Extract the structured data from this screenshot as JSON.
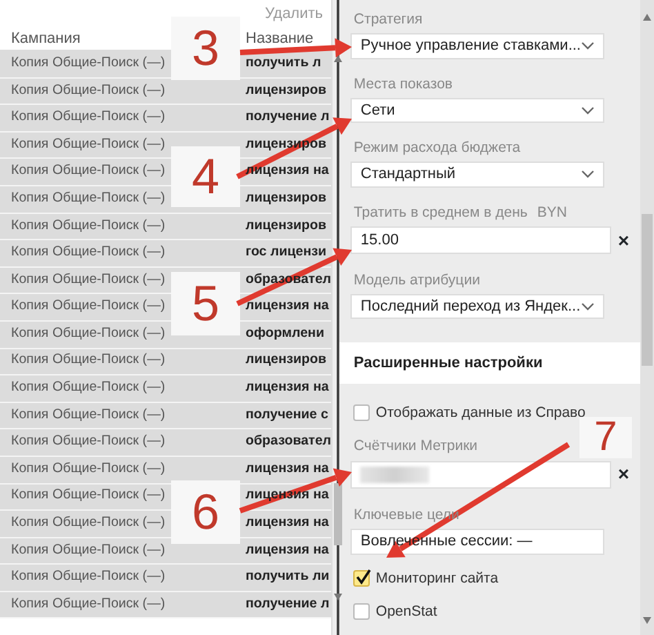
{
  "toolbar": {
    "delete_link": "Удалить"
  },
  "table": {
    "columns": [
      "Кампания",
      "Название"
    ],
    "rows": [
      {
        "campaign": "Копия Общие-Поиск (—)",
        "name": "получить л"
      },
      {
        "campaign": "Копия Общие-Поиск (—)",
        "name": "лицензиров"
      },
      {
        "campaign": "Копия Общие-Поиск (—)",
        "name": "получение л"
      },
      {
        "campaign": "Копия Общие-Поиск (—)",
        "name": "лицензиров"
      },
      {
        "campaign": "Копия Общие-Поиск (—)",
        "name": "лицензия на"
      },
      {
        "campaign": "Копия Общие-Поиск (—)",
        "name": "лицензиров"
      },
      {
        "campaign": "Копия Общие-Поиск (—)",
        "name": "лицензиров"
      },
      {
        "campaign": "Копия Общие-Поиск (—)",
        "name": "гос лицензи"
      },
      {
        "campaign": "Копия Общие-Поиск (—)",
        "name": "образовател"
      },
      {
        "campaign": "Копия Общие-Поиск (—)",
        "name": "лицензия на"
      },
      {
        "campaign": "Копия Общие-Поиск (—)",
        "name": "оформлени"
      },
      {
        "campaign": "Копия Общие-Поиск (—)",
        "name": "лицензиров"
      },
      {
        "campaign": "Копия Общие-Поиск (—)",
        "name": "лицензия на"
      },
      {
        "campaign": "Копия Общие-Поиск (—)",
        "name": "получение с"
      },
      {
        "campaign": "Копия Общие-Поиск (—)",
        "name": "образовател"
      },
      {
        "campaign": "Копия Общие-Поиск (—)",
        "name": "лицензия на"
      },
      {
        "campaign": "Копия Общие-Поиск (—)",
        "name": "лицензия на"
      },
      {
        "campaign": "Копия Общие-Поиск (—)",
        "name": "лицензия на"
      },
      {
        "campaign": "Копия Общие-Поиск (—)",
        "name": "лицензия на"
      },
      {
        "campaign": "Копия Общие-Поиск (—)",
        "name": "получить ли"
      },
      {
        "campaign": "Копия Общие-Поиск (—)",
        "name": "получение л"
      }
    ]
  },
  "settings": {
    "fields": [
      {
        "kind": "select",
        "label": "Стратегия",
        "value": "Ручное управление ставками..."
      },
      {
        "kind": "select",
        "label": "Места показов",
        "value": "Сети"
      },
      {
        "kind": "select",
        "label": "Режим расхода бюджета",
        "value": "Стандартный"
      },
      {
        "kind": "input",
        "label": "Тратить в среднем в день",
        "unit": "BYN",
        "value": "15.00",
        "clear": "×"
      },
      {
        "kind": "select",
        "label": "Модель атрибуции",
        "value": "Последний переход из Яндек..."
      },
      {
        "kind": "section",
        "label": "Расширенные настройки"
      },
      {
        "kind": "checkbox",
        "label": "Отображать данные из Справо",
        "checked": false
      },
      {
        "kind": "redacted",
        "label": "Счётчики Метрики",
        "clear": "×"
      },
      {
        "kind": "text",
        "label": "Ключевые цели",
        "value": "Вовлеченные сессии: —"
      },
      {
        "kind": "checkbox",
        "label": "Мониторинг сайта",
        "checked": true
      },
      {
        "kind": "checkbox",
        "label": "OpenStat",
        "checked": false
      }
    ]
  },
  "annotations": [
    {
      "label": "3"
    },
    {
      "label": "4"
    },
    {
      "label": "5"
    },
    {
      "label": "6"
    },
    {
      "label": "7"
    }
  ]
}
